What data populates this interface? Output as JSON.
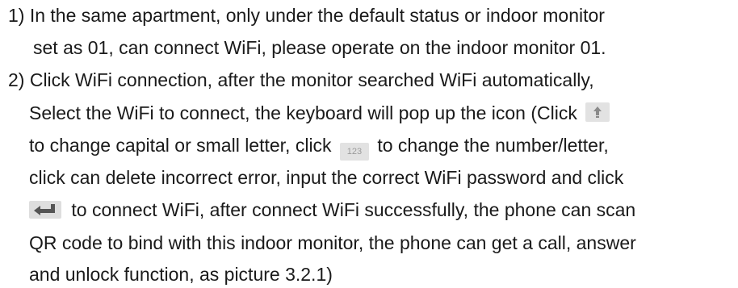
{
  "lines": [
    "1) In the same apartment, only under the default status or indoor monitor",
    "set as 01, can connect WiFi, please operate on the indoor monitor 01.",
    "2) Click WiFi connection, after the monitor searched WiFi automatically,",
    "Select the WiFi to connect, the keyboard will pop up the icon (Click",
    "to change capital or small letter, click",
    "to change the number/letter,",
    "click can  delete incorrect error, input the correct WiFi password and click",
    "to connect WiFi, after connect WiFi successfully, the phone can scan",
    "QR code to bind with this indoor monitor, the phone can get a call, answer",
    "and unlock function, as picture 3.2.1)"
  ],
  "icons": {
    "shift": "shift-arrow-icon",
    "numbers_key_label": "123",
    "enter": "enter-return-icon"
  },
  "colors": {
    "text": "#1a1a1a",
    "key_background": "#e2e2e2",
    "icon_gray": "#555555"
  }
}
